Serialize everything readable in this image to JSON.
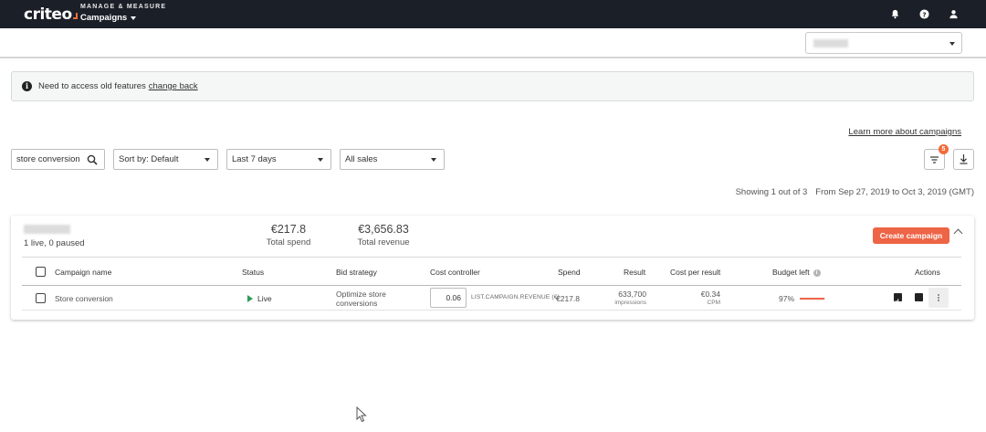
{
  "topbar": {
    "logo": "criteo",
    "section_label": "MANAGE & MEASURE",
    "nav_title": "Campaigns",
    "icons": [
      "bell-icon",
      "help-icon",
      "user-icon"
    ]
  },
  "banner": {
    "text": "Need to access old features",
    "link": "change back"
  },
  "learn_link": "Learn more about campaigns",
  "filters": {
    "search_value": "store conversion",
    "sort": "Sort by: Default",
    "date_range": "Last 7 days",
    "sales": "All sales",
    "filter_count": "5"
  },
  "showing": {
    "count": "Showing 1 out of 3",
    "range": "From Sep 27, 2019 to Oct 3, 2019 (GMT)"
  },
  "card": {
    "status": "1 live, 0 paused",
    "total_spend_value": "€217.8",
    "total_spend_label": "Total spend",
    "total_revenue_value": "€3,656.83",
    "total_revenue_label": "Total revenue",
    "create_button": "Create campaign"
  },
  "table": {
    "headers": {
      "name": "Campaign name",
      "status": "Status",
      "bid": "Bid strategy",
      "cost_controller": "Cost controller",
      "spend": "Spend",
      "result": "Result",
      "cost_per_result": "Cost per result",
      "budget": "Budget left",
      "actions": "Actions"
    },
    "rows": [
      {
        "name": "Store conversion",
        "status": "Live",
        "bid": "Optimize store conversions",
        "cost_controller_value": "0.06",
        "cost_controller_label": "LIST.CAMPAIGN.REVENUE (€)",
        "spend": "€217.8",
        "result_value": "633,700",
        "result_unit": "impressions",
        "cpr_value": "€0.34",
        "cpr_unit": "CPM",
        "budget_left": "97%",
        "budget_fraction": 0.97
      }
    ]
  },
  "colors": {
    "accent": "#ee6446",
    "topbar": "#1b1f28",
    "live": "#2e9e58"
  }
}
